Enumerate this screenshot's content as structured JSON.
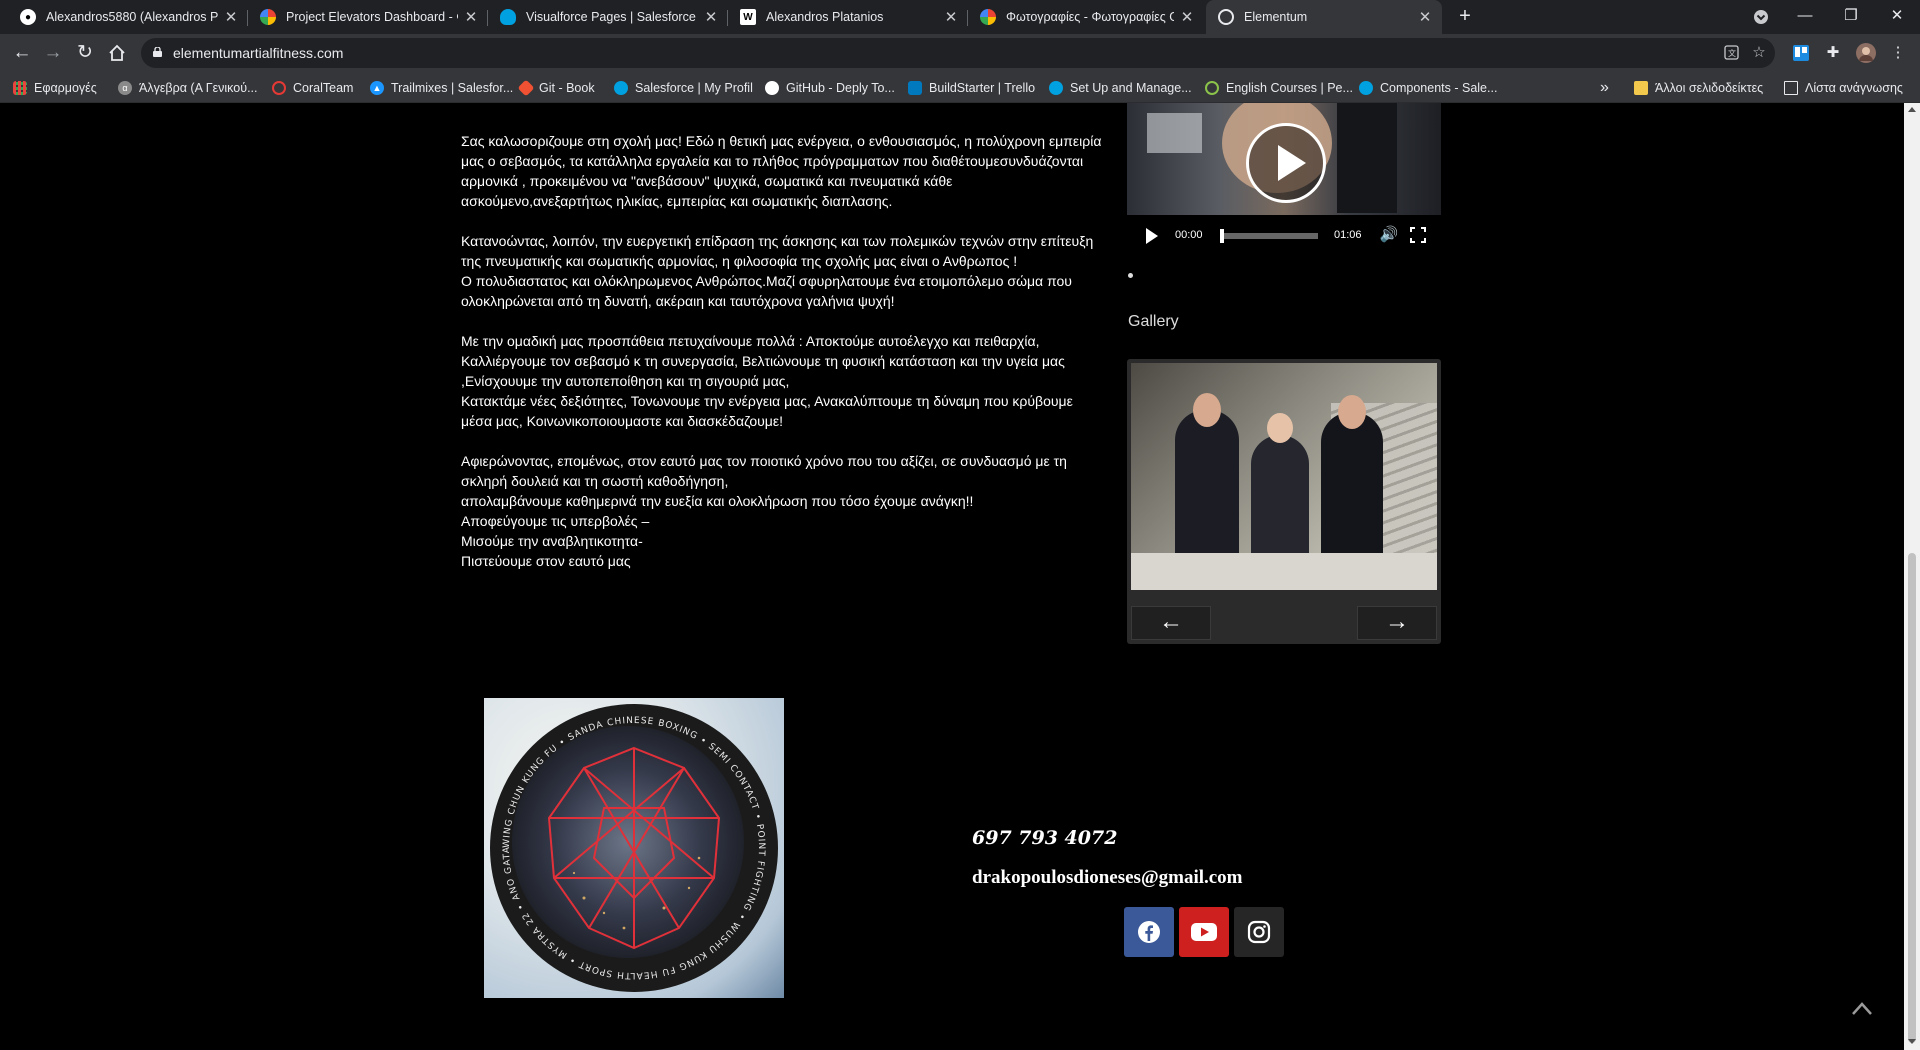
{
  "browser": {
    "tabs": [
      {
        "title": "Alexandros5880 (Alexandros Plat",
        "icon": "github-icon",
        "color": "#ffffff"
      },
      {
        "title": "Project Elevators Dashboard - Φω",
        "icon": "google-photos-icon",
        "color": "#fbbc04"
      },
      {
        "title": "Visualforce Pages | Salesforce",
        "icon": "salesforce-icon",
        "color": "#00a1e0"
      },
      {
        "title": "Alexandros Platanios",
        "icon": "wikipedia-icon",
        "color": "#ffffff"
      },
      {
        "title": "Φωτογραφίες - Φωτογραφίες G",
        "icon": "google-photos-icon",
        "color": "#fbbc04"
      },
      {
        "title": "Elementum",
        "icon": "page-icon",
        "color": "#ffffff"
      }
    ],
    "new_tab": "+",
    "url": "elementumartialfitness.com",
    "bookmarks": [
      {
        "label": "Εφαρμογές",
        "icon": "apps-icon",
        "color": "#e8453c"
      },
      {
        "label": "Άλγεβρα (Α Γενικού...",
        "icon": "site-icon",
        "color": "#8a8a8a"
      },
      {
        "label": "CoralTeam",
        "icon": "site-icon",
        "color": "#e53935"
      },
      {
        "label": "Trailmixes | Salesfor...",
        "icon": "trailhead-icon",
        "color": "#1b96ff"
      },
      {
        "label": "Git - Book",
        "icon": "git-icon",
        "color": "#f05133"
      },
      {
        "label": "Salesforce | My Profil",
        "icon": "salesforce-icon",
        "color": "#00a1e0"
      },
      {
        "label": "GitHub - Deply To...",
        "icon": "github-icon",
        "color": "#ffffff"
      },
      {
        "label": "BuildStarter | Trello",
        "icon": "trello-icon",
        "color": "#0079bf"
      },
      {
        "label": "Set Up and Manage...",
        "icon": "salesforce-icon",
        "color": "#00a1e0"
      },
      {
        "label": "English Courses | Pe...",
        "icon": "site-icon",
        "color": "#8bc34a"
      },
      {
        "label": "Components - Sale...",
        "icon": "salesforce-icon",
        "color": "#00a1e0"
      }
    ],
    "more_bookmarks": "»",
    "other_bookmarks": "Άλλοι σελιδοδείκτες",
    "reading_list": "Λίστα ανάγνωσης"
  },
  "intro": {
    "paragraphs": [
      [
        "Σας καλωσοριζουμε στη σχολή μας! Εδώ η θετική μας ενέργεια, ο ενθουσιασμός, η πολύχρονη εμπειρία",
        "μας ο σεβασμός, τα κατάλληλα εργαλεία και το πλήθος πρόγραμματων που διαθέτουμεσυνδυάζονται",
        "αρμονικά , προκειμένου να \"ανεβάσουν\" ψυχικά, σωματικά και πνευματικά κάθε",
        "ασκούμενο,ανεξαρτήτως ηλικίας, εμπειρίας και σωματικής διαπλασης."
      ],
      [
        "Κατανοώντας, λοιπόν, την ευεργετική επίδραση της άσκησης και των πολεμικών τεχνών στην επίτευξη",
        "της πνευματικής και σωματικής αρμονίας, η φιλοσοφία της σχολής μας είναι ο Ανθρωπος !",
        "Ο πολυδιαστατος και ολόκληρωμενος Ανθρώπος.Μαζί σφυρηλατουμε ένα ετοιμοπόλεμο σώμα που",
        "ολοκληρώνεται από τη δυνατή, ακέραιη και ταυτόχρονα γαλήνια ψυχή!"
      ],
      [
        "Με την ομαδική μας προσπάθεια πετυχαίνουμε πολλά : Αποκτούμε αυτοέλεγχο και πειθαρχία,",
        "Καλλιέργουμε τον σεβασμό κ τη συνεργασία, Βελτιώνουμε τη φυσική κατάσταση και την υγεία μας",
        ",Ενίσχουυμε την αυτοπεποίθηση και τη σιγουριά μας,",
        "Κατακτάμε νέες δεξιότητες, Τονωνουμε την ενέργεια μας, Ανακαλύπτουμε τη δύναμη που κρύβουμε",
        "μέσα μας, Κοινωνικοποιουμαστε και διασκέδαζουμε!"
      ],
      [
        "Αφιερώνοντας, επομένως, στον εαυτό μας τον ποιοτικό χρόνο που του αξίζει, σε συνδυασμό με τη",
        "σκληρή δουλειά και τη σωστή καθοδήγηση,",
        "απολαμβάνουμε καθημερινά την ευεξία και ολοκλήρωση που τόσο έχουμε ανάγκη!!",
        "Αποφεύγουμε τις υπερβολές –",
        "Μισούμε την αναβλητικοτητα-",
        "Πιστεύουμε στον εαυτό μας"
      ]
    ]
  },
  "video": {
    "current_time": "00:00",
    "duration": "01:06",
    "progress": 0.0
  },
  "gallery": {
    "title": "Gallery",
    "prev_label": "←",
    "next_label": "→"
  },
  "logo": {
    "ring_text": "WING CHUN KUNG FU • SANDA CHINESE BOXING • SEMI CONTACT • POINT FIGHTING • WUSHU KUNG FU HEALTH SPORT • MYSTRA 22 • ANO GATADA"
  },
  "contact": {
    "phone": "697 793 4072",
    "email": "drakopoulosdioneses@gmail.com"
  },
  "social": [
    {
      "name": "facebook",
      "color": "#3b5998"
    },
    {
      "name": "youtube",
      "color": "#cd201f"
    },
    {
      "name": "instagram",
      "color": "#262626"
    }
  ]
}
